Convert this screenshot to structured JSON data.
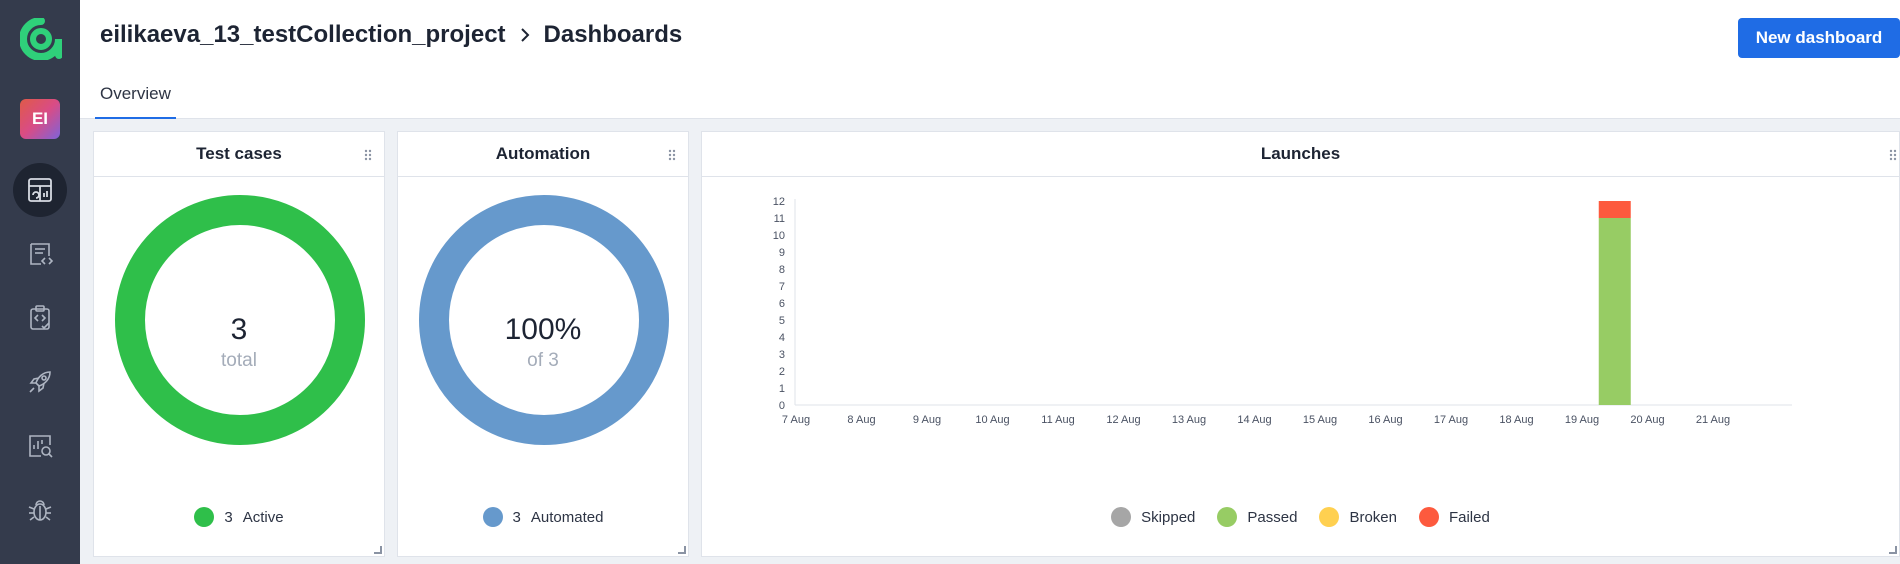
{
  "sidebar": {
    "avatar_initials": "EI",
    "items": [
      {
        "name": "dashboards",
        "icon": "dashboard-icon",
        "active": true
      },
      {
        "name": "test-cases",
        "icon": "test-cases-icon",
        "active": false
      },
      {
        "name": "test-plans",
        "icon": "clipboard-code-icon",
        "active": false
      },
      {
        "name": "launches",
        "icon": "rocket-icon",
        "active": false
      },
      {
        "name": "analytics",
        "icon": "analytics-search-icon",
        "active": false
      },
      {
        "name": "defects",
        "icon": "bug-icon",
        "active": false
      }
    ]
  },
  "header": {
    "project": "eilikaeva_13_testCollection_project",
    "page": "Dashboards",
    "new_button": "New dashboard"
  },
  "tabs": [
    {
      "label": "Overview",
      "active": true
    }
  ],
  "widgets": {
    "test_cases": {
      "title": "Test cases",
      "value": "3",
      "sub": "total",
      "legend_count": "3",
      "legend_label": "Active",
      "color": "#2fbf4a"
    },
    "automation": {
      "title": "Automation",
      "value": "100%",
      "sub": "of 3",
      "legend_count": "3",
      "legend_label": "Automated",
      "color": "#6699cc"
    },
    "launches": {
      "title": "Launches"
    }
  },
  "chart_data": {
    "type": "bar",
    "title": "Launches",
    "categories": [
      "7 Aug",
      "8 Aug",
      "9 Aug",
      "10 Aug",
      "11 Aug",
      "12 Aug",
      "13 Aug",
      "14 Aug",
      "15 Aug",
      "16 Aug",
      "17 Aug",
      "18 Aug",
      "19 Aug",
      "20 Aug",
      "21 Aug"
    ],
    "bar_position": "19 Aug",
    "series": [
      {
        "name": "Skipped",
        "color": "#a6a6a6",
        "values": [
          0,
          0,
          0,
          0,
          0,
          0,
          0,
          0,
          0,
          0,
          0,
          0,
          0,
          0,
          0
        ]
      },
      {
        "name": "Passed",
        "color": "#97cc64",
        "values": [
          0,
          0,
          0,
          0,
          0,
          0,
          0,
          0,
          0,
          0,
          0,
          0,
          11,
          0,
          0
        ]
      },
      {
        "name": "Broken",
        "color": "#ffd050",
        "values": [
          0,
          0,
          0,
          0,
          0,
          0,
          0,
          0,
          0,
          0,
          0,
          0,
          0,
          0,
          0
        ]
      },
      {
        "name": "Failed",
        "color": "#fd5a3e",
        "values": [
          0,
          0,
          0,
          0,
          0,
          0,
          0,
          0,
          0,
          0,
          0,
          0,
          1,
          0,
          0
        ]
      }
    ],
    "stacked": true,
    "yticks": [
      0,
      1,
      2,
      3,
      4,
      5,
      6,
      7,
      8,
      9,
      10,
      11,
      12
    ],
    "ylim": [
      0,
      12
    ],
    "legend_position": "bottom"
  }
}
